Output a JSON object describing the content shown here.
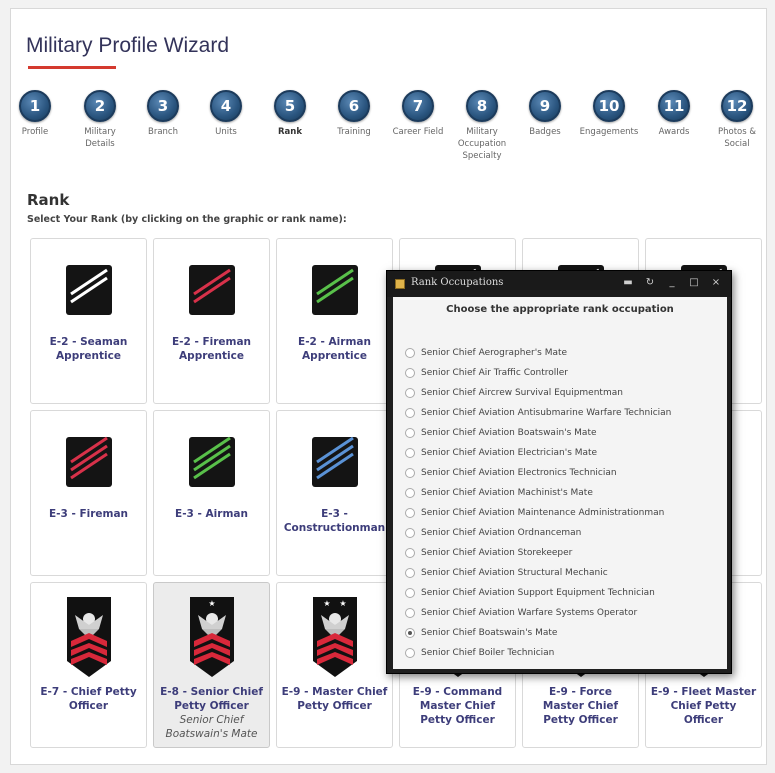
{
  "app": {
    "title": "Military Profile Wizard"
  },
  "steps": [
    {
      "num": "1",
      "label": "Profile"
    },
    {
      "num": "2",
      "label": "Military Details"
    },
    {
      "num": "3",
      "label": "Branch"
    },
    {
      "num": "4",
      "label": "Units"
    },
    {
      "num": "5",
      "label": "Rank",
      "active": true
    },
    {
      "num": "6",
      "label": "Training"
    },
    {
      "num": "7",
      "label": "Career Field"
    },
    {
      "num": "8",
      "label": "Military Occupation Specialty"
    },
    {
      "num": "9",
      "label": "Badges"
    },
    {
      "num": "10",
      "label": "Engagements"
    },
    {
      "num": "11",
      "label": "Awards"
    },
    {
      "num": "12",
      "label": "Photos & Social"
    }
  ],
  "rank_section": {
    "heading": "Rank",
    "instruction": "Select Your Rank (by clicking on the graphic or rank name):"
  },
  "ranks": [
    {
      "label": "E-2 - Seaman Apprentice",
      "insignia": "two-stripes-white-icon"
    },
    {
      "label": "E-2 - Fireman Apprentice",
      "insignia": "two-stripes-red-icon"
    },
    {
      "label": "E-2 - Airman Apprentice",
      "insignia": "two-stripes-green-icon"
    },
    {
      "label": "",
      "insignia": "two-stripes-icon"
    },
    {
      "label": "",
      "insignia": "two-stripes-icon"
    },
    {
      "label": "man",
      "insignia": "two-stripes-icon"
    },
    {
      "label": "E-3 - Fireman",
      "insignia": "three-stripes-red-icon"
    },
    {
      "label": "E-3 - Airman",
      "insignia": "three-stripes-green-icon"
    },
    {
      "label": "E-3 - Constructionman",
      "insignia": "three-stripes-blue-icon"
    },
    {
      "label": "",
      "insignia": "three-stripes-icon"
    },
    {
      "label": "",
      "insignia": "three-stripes-icon"
    },
    {
      "label": "fficer",
      "insignia": "three-stripes-icon"
    },
    {
      "label": "E-7 - Chief Petty Officer",
      "insignia": "eagle-chevrons-icon"
    },
    {
      "label": "E-8 - Senior Chief Petty Officer",
      "insignia": "eagle-chevrons-star-icon",
      "occupation": "Senior Chief Boatswain's Mate",
      "selected": true
    },
    {
      "label": "E-9 - Master Chief Petty Officer",
      "insignia": "eagle-chevrons-two-stars-icon"
    },
    {
      "label": "E-9 - Command Master Chief Petty Officer",
      "insignia": "eagle-chevrons-icon"
    },
    {
      "label": "E-9 - Force Master Chief Petty Officer",
      "insignia": "eagle-chevrons-icon"
    },
    {
      "label": "E-9 - Fleet Master Chief Petty Officer",
      "insignia": "eagle-chevrons-icon"
    }
  ],
  "dialog": {
    "title": "Rank Occupations",
    "prompt": "Choose the appropriate rank occupation",
    "options": [
      {
        "label": "Senior Chief Aerographer's Mate",
        "checked": false
      },
      {
        "label": "Senior Chief Air Traffic Controller",
        "checked": false
      },
      {
        "label": "Senior Chief Aircrew Survival Equipmentman",
        "checked": false
      },
      {
        "label": "Senior Chief Aviation Antisubmarine Warfare Technician",
        "checked": false
      },
      {
        "label": "Senior Chief Aviation Boatswain's Mate",
        "checked": false
      },
      {
        "label": "Senior Chief Aviation Electrician's Mate",
        "checked": false
      },
      {
        "label": "Senior Chief Aviation Electronics Technician",
        "checked": false
      },
      {
        "label": "Senior Chief Aviation Machinist's Mate",
        "checked": false
      },
      {
        "label": "Senior Chief Aviation Maintenance Administrationman",
        "checked": false
      },
      {
        "label": "Senior Chief Aviation Ordnanceman",
        "checked": false
      },
      {
        "label": "Senior Chief Aviation Storekeeper",
        "checked": false
      },
      {
        "label": "Senior Chief Aviation Structural Mechanic",
        "checked": false
      },
      {
        "label": "Senior Chief Aviation Support Equipment Technician",
        "checked": false
      },
      {
        "label": "Senior Chief Aviation Warfare Systems Operator",
        "checked": false
      },
      {
        "label": "Senior Chief Boatswain's Mate",
        "checked": true
      },
      {
        "label": "Senior Chief Boiler Technician",
        "checked": false
      }
    ]
  },
  "colors": {
    "title": "#33335a",
    "accent_underline": "#d43a2f",
    "step_circle": "#2a557f",
    "rank_label": "#3d3d7a",
    "stripe_white": "#ffffff",
    "stripe_red": "#d8314a",
    "stripe_green": "#59c04a",
    "stripe_blue": "#5a92d6",
    "chevron_red": "#d8283a"
  }
}
